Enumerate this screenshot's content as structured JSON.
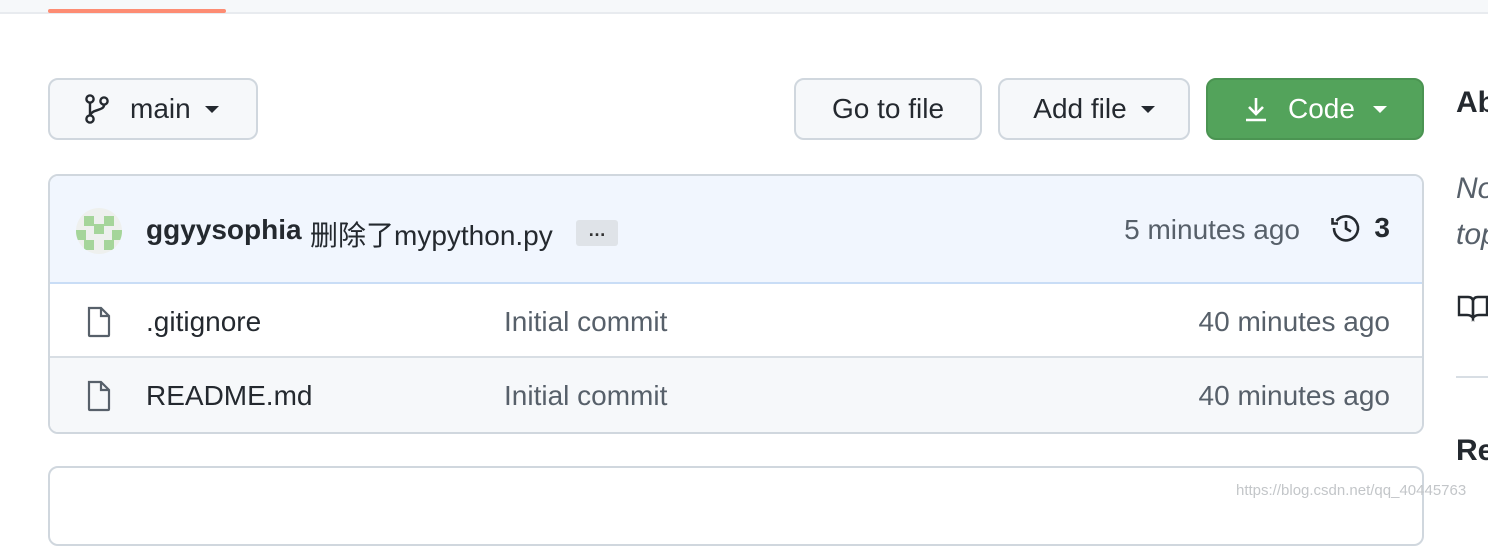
{
  "nav": {
    "active_tab_color": "#fd8c73"
  },
  "toolbar": {
    "branch": "main",
    "go_to_file": "Go to file",
    "add_file": "Add file",
    "code": "Code",
    "code_color": "#53a35b"
  },
  "latest_commit": {
    "author": "ggyysophia",
    "message": "删除了mypython.py",
    "ellipsis": "…",
    "time": "5 minutes ago",
    "commit_count": "3"
  },
  "files": [
    {
      "name": ".gitignore",
      "icon": "file-icon",
      "commit": "Initial commit",
      "time": "40 minutes ago"
    },
    {
      "name": "README.md",
      "icon": "file-icon",
      "commit": "Initial commit",
      "time": "40 minutes ago"
    }
  ],
  "sidebar": {
    "about_heading": "Ab",
    "description": "No\ntop",
    "readme_icon": "book-icon",
    "releases_heading": "Re"
  },
  "watermark": "https://blog.csdn.net/qq_40445763"
}
